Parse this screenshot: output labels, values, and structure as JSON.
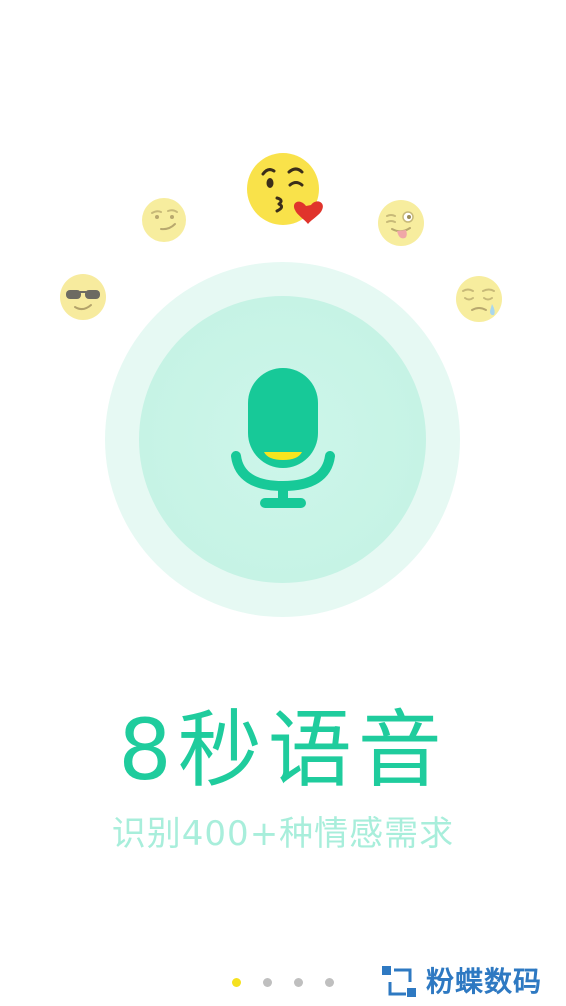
{
  "colors": {
    "accent": "#1fcc9d",
    "accent_light": "#a8eedb",
    "circle_outer": "#e6f9f3",
    "circle_inner": "#c6f3e5",
    "mic_body": "#17c998",
    "mic_stripe": "#f7e51e",
    "emoji_yellow": "#f9e24a",
    "dot_active": "#f5e11f",
    "dot_inactive": "#bfbfbf",
    "watermark": "#2e79c2"
  },
  "emojis": [
    {
      "name": "cool-sunglasses-emoji-icon"
    },
    {
      "name": "smirk-emoji-icon"
    },
    {
      "name": "blowing-kiss-emoji-icon"
    },
    {
      "name": "wink-tongue-emoji-icon"
    },
    {
      "name": "sad-crying-emoji-icon"
    }
  ],
  "mic": {
    "icon": "microphone-icon"
  },
  "headline": "8秒语音",
  "subline": "识别400+种情感需求",
  "pager": {
    "count": 4,
    "active_index": 0
  },
  "watermark": {
    "text": "粉蝶数码"
  }
}
